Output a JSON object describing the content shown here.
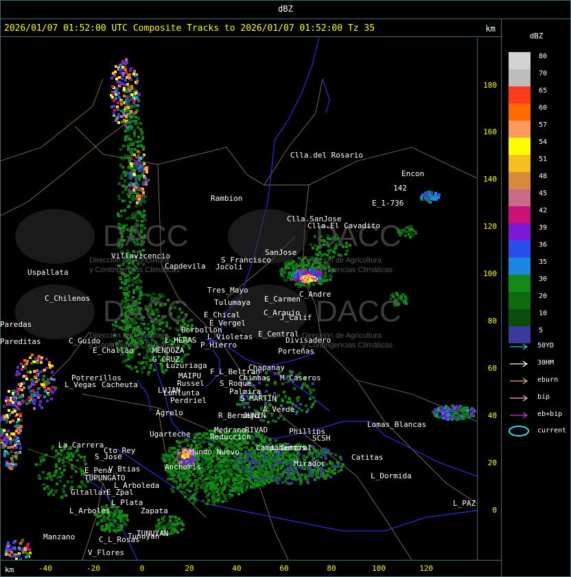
{
  "header": {
    "unit_label": "dBZ"
  },
  "title_bar": {
    "text": "2026/01/07 01:52:00 UTC Composite Tracks to 2026/01/07 01:52:00 Tz 35",
    "km_label": "km"
  },
  "axes": {
    "x_label": "km",
    "x_ticks": [
      "-40",
      "-20",
      "0",
      "20",
      "40",
      "60",
      "80",
      "100",
      "120"
    ],
    "y_ticks": [
      "180",
      "160",
      "140",
      "120",
      "100",
      "80",
      "60",
      "40",
      "20",
      "0"
    ]
  },
  "legend": {
    "title": "dBZ",
    "levels": [
      {
        "label": "80",
        "color": "#d3d3d3"
      },
      {
        "label": "70",
        "color": "#bdbdbd"
      },
      {
        "label": "65",
        "color": "#ff3a1f"
      },
      {
        "label": "60",
        "color": "#ff6a00"
      },
      {
        "label": "57",
        "color": "#ff9a5c"
      },
      {
        "label": "54",
        "color": "#ffff00"
      },
      {
        "label": "51",
        "color": "#f7c020"
      },
      {
        "label": "48",
        "color": "#d8893a"
      },
      {
        "label": "45",
        "color": "#c96a8a"
      },
      {
        "label": "42",
        "color": "#d0107a"
      },
      {
        "label": "39",
        "color": "#7a1ad8"
      },
      {
        "label": "36",
        "color": "#2a4df0"
      },
      {
        "label": "35",
        "color": "#1a86e0"
      },
      {
        "label": "30",
        "color": "#138a13"
      },
      {
        "label": "20",
        "color": "#0e6a0e"
      },
      {
        "label": "10",
        "color": "#0a4d0a"
      },
      {
        "label": "5",
        "color": "#3a3a9a"
      }
    ],
    "tracks": [
      {
        "label": "50YD",
        "color": "#39c6c6"
      },
      {
        "label": "30HM",
        "color": "#ffffff"
      },
      {
        "label": "eburn",
        "color": "#f0b070"
      },
      {
        "label": "bip",
        "color": "#ffb0c0"
      },
      {
        "label": "eb+bip",
        "color": "#d040d0"
      }
    ],
    "current_label": "current",
    "current_color": "#30e0f0"
  },
  "watermark": {
    "brand": "DACC",
    "line1": "Dirección de Agricultura",
    "line2": "y Contingencias Climáticas"
  },
  "places": [
    {
      "name": "Clla.del Rosario"
    },
    {
      "name": "Encon"
    },
    {
      "name": "Rambion"
    },
    {
      "name": "E_1-736"
    },
    {
      "name": "142"
    },
    {
      "name": "Clla.SanJose"
    },
    {
      "name": "Clla.El Cavadito"
    },
    {
      "name": "Villavicencio"
    },
    {
      "name": "Capdevila"
    },
    {
      "name": "S_Francisco"
    },
    {
      "name": "SanJose"
    },
    {
      "name": "Uspallata"
    },
    {
      "name": "Jocoli"
    },
    {
      "name": "Tres_Mayo"
    },
    {
      "name": "Tulumaya"
    },
    {
      "name": "C_Andre"
    },
    {
      "name": "E_Carmen"
    },
    {
      "name": "C_Chilenos"
    },
    {
      "name": "E_Chical"
    },
    {
      "name": "E_Vergel"
    },
    {
      "name": "C_Araujo"
    },
    {
      "name": "J_Calif"
    },
    {
      "name": "Paredas"
    },
    {
      "name": "Borbollon"
    },
    {
      "name": "L_Violetas"
    },
    {
      "name": "E_Central"
    },
    {
      "name": "Divisadero"
    },
    {
      "name": "L_HERAS"
    },
    {
      "name": "P_Hierro"
    },
    {
      "name": "C_Guido"
    },
    {
      "name": "E_Challao"
    },
    {
      "name": "MENDOZA"
    },
    {
      "name": "G_CRUZ"
    },
    {
      "name": "Porteñas"
    },
    {
      "name": "Luzuriaga"
    },
    {
      "name": "Chapanay"
    },
    {
      "name": "F_L_Beltran"
    },
    {
      "name": "Chimbas"
    },
    {
      "name": "M_Caseros"
    },
    {
      "name": "Potrerillos"
    },
    {
      "name": "L_Vegas"
    },
    {
      "name": "Cacheuta"
    },
    {
      "name": "MAIPU"
    },
    {
      "name": "Russel"
    },
    {
      "name": "LUJAN"
    },
    {
      "name": "Lunlunta"
    },
    {
      "name": "S_Roque"
    },
    {
      "name": "Palmira"
    },
    {
      "name": "Perdriel"
    },
    {
      "name": "S_MARTIN"
    },
    {
      "name": "A_Verde"
    },
    {
      "name": "Agrelo"
    },
    {
      "name": "R_Bermejo"
    },
    {
      "name": "JUNIN"
    },
    {
      "name": "Medrano"
    },
    {
      "name": "Lomas_Blancas"
    },
    {
      "name": "La_Carrera"
    },
    {
      "name": "Ugarteche"
    },
    {
      "name": "Anchoris"
    },
    {
      "name": "Phillips"
    },
    {
      "name": "Cto_Rey"
    },
    {
      "name": "S_Jose"
    },
    {
      "name": "Reduccion"
    },
    {
      "name": "RIVAD"
    },
    {
      "name": "Mundo_Nuevo"
    },
    {
      "name": "Campamentos"
    },
    {
      "name": "L_Central"
    },
    {
      "name": "E_Pena"
    },
    {
      "name": "V_Btias"
    },
    {
      "name": "TUPUNGATO"
    },
    {
      "name": "Catitas"
    },
    {
      "name": "L_Arboleda"
    },
    {
      "name": "Mirador"
    },
    {
      "name": "L_Dormida"
    },
    {
      "name": "Gltallar"
    },
    {
      "name": "E_Zpal"
    },
    {
      "name": "L_Plata"
    },
    {
      "name": "L_Arboles"
    },
    {
      "name": "Zapata"
    },
    {
      "name": "L_PAZ"
    },
    {
      "name": "Pareditas"
    },
    {
      "name": "Tunuyan"
    },
    {
      "name": "Manzano"
    },
    {
      "name": "C_L_Rosas"
    },
    {
      "name": "V_Flores"
    },
    {
      "name": "TUNUYAN"
    },
    {
      "name": "SCSH"
    }
  ]
}
